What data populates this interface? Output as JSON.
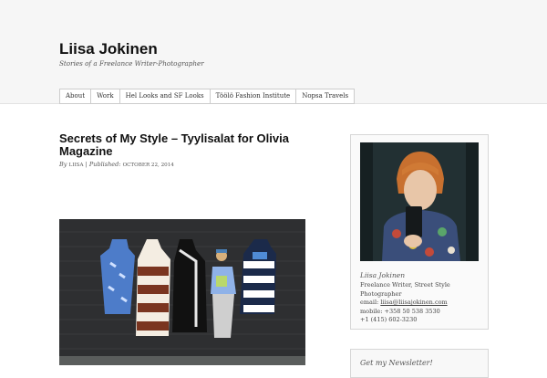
{
  "site": {
    "title": "Liisa Jokinen",
    "description": "Stories of a Freelance Writer-Photographer"
  },
  "nav": {
    "items": [
      {
        "label": "About"
      },
      {
        "label": "Work"
      },
      {
        "label": "Hel Looks and SF Looks"
      },
      {
        "label": "Töölö Fashion Institute"
      },
      {
        "label": "Nopsa Travels"
      }
    ]
  },
  "post": {
    "title": "Secrets of My Style – Tyylisalat for Olivia Magazine",
    "byline_prefix": "By",
    "author": "LIISA",
    "separator": "| Published:",
    "date": "OCTOBER 22, 2014"
  },
  "sidebar": {
    "author_name": "Liisa Jokinen",
    "role": "Freelance Writer, Street Style Photographer",
    "email_label": "email:",
    "email": "liisa@liisajokinen.com",
    "mobile": "mobile: +358 50 538 3530",
    "phone": "+1 (415) 602-3230",
    "newsletter_title": "Get my Newsletter!"
  }
}
